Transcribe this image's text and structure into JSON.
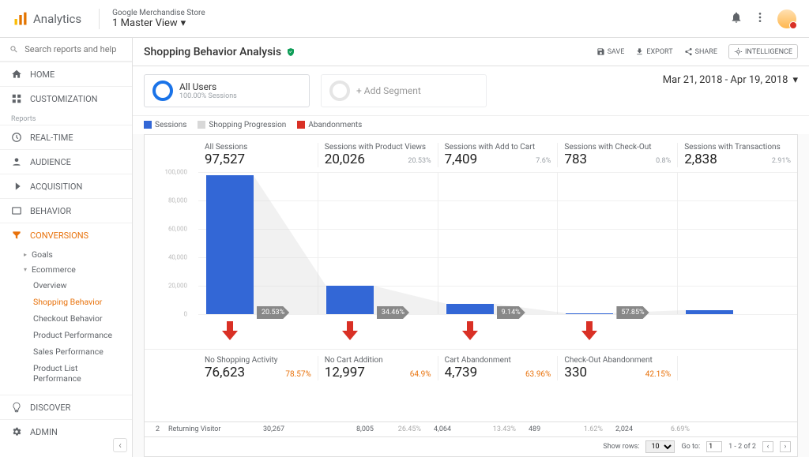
{
  "header": {
    "product": "Analytics",
    "account": "Google Merchandise Store",
    "view": "1 Master View"
  },
  "sidebar": {
    "search_placeholder": "Search reports and help",
    "home": "HOME",
    "customization": "CUSTOMIZATION",
    "reports_label": "Reports",
    "realtime": "REAL-TIME",
    "audience": "AUDIENCE",
    "acquisition": "ACQUISITION",
    "behavior": "BEHAVIOR",
    "conversions": "CONVERSIONS",
    "goals": "Goals",
    "ecommerce": "Ecommerce",
    "subs": {
      "overview": "Overview",
      "shopping": "Shopping Behavior",
      "checkout": "Checkout Behavior",
      "product": "Product Performance",
      "sales": "Sales Performance",
      "plist": "Product List Performance"
    },
    "discover": "DISCOVER",
    "admin": "ADMIN"
  },
  "page": {
    "title": "Shopping Behavior Analysis",
    "save": "SAVE",
    "export": "EXPORT",
    "share": "SHARE",
    "intelligence": "INTELLIGENCE",
    "daterange": "Mar 21, 2018 - Apr 19, 2018"
  },
  "segments": {
    "all_users": "All Users",
    "all_users_sub": "100.00% Sessions",
    "add": "+ Add Segment"
  },
  "legend": {
    "sessions": "Sessions",
    "progression": "Shopping Progression",
    "abandon": "Abandonments"
  },
  "chart_data": {
    "type": "bar",
    "ylim": [
      0,
      100000
    ],
    "yticks": [
      0,
      20000,
      40000,
      60000,
      80000,
      100000
    ],
    "stages": [
      {
        "label": "All Sessions",
        "value": 97527,
        "pct": null,
        "flow_pct": 20.53
      },
      {
        "label": "Sessions with Product Views",
        "value": 20026,
        "pct": 20.53,
        "flow_pct": 34.46
      },
      {
        "label": "Sessions with Add to Cart",
        "value": 7409,
        "pct": 7.6,
        "flow_pct": 9.14
      },
      {
        "label": "Sessions with Check-Out",
        "value": 783,
        "pct": 0.8,
        "flow_pct": 57.85
      },
      {
        "label": "Sessions with Transactions",
        "value": 2838,
        "pct": 2.91,
        "flow_pct": null
      }
    ],
    "abandonments": [
      {
        "label": "No Shopping Activity",
        "value": 76623,
        "pct": 78.57
      },
      {
        "label": "No Cart Addition",
        "value": 12997,
        "pct": 64.9
      },
      {
        "label": "Cart Abandonment",
        "value": 4739,
        "pct": 63.96
      },
      {
        "label": "Check-Out Abandonment",
        "value": 330,
        "pct": 42.15
      }
    ]
  },
  "table": {
    "row_idx": "2",
    "row_label": "Returning Visitor",
    "cells": [
      "30,267",
      "8,005",
      "26.45%",
      "4,064",
      "13.43%",
      "489",
      "1.62%",
      "2,024",
      "6.69%"
    ]
  },
  "pager": {
    "show_rows": "Show rows:",
    "rows_val": "10",
    "goto": "Go to:",
    "goto_val": "1",
    "range": "1 - 2 of 2"
  }
}
